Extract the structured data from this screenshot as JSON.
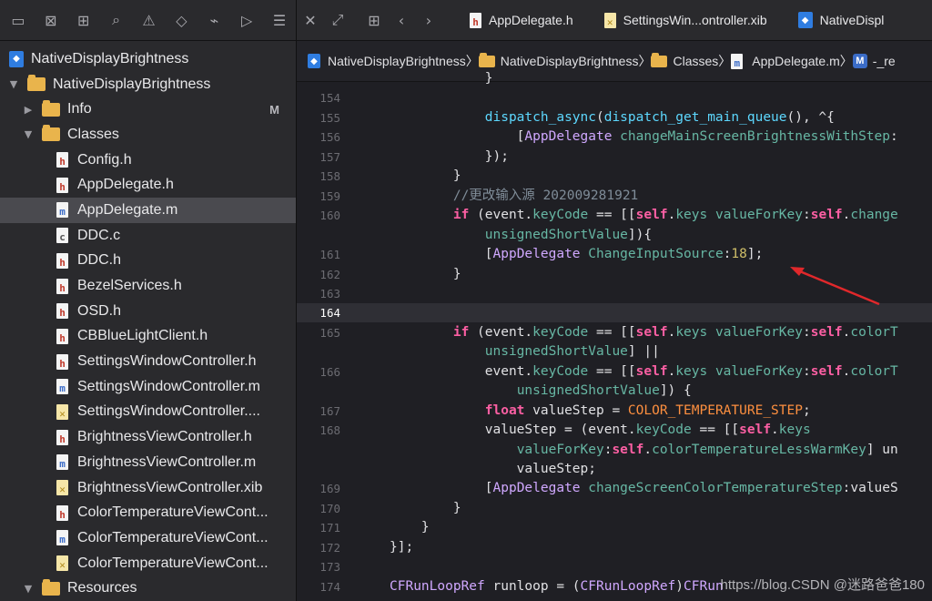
{
  "sidebar": {
    "toolbar_icons": [
      "folder-icon",
      "close-box-icon",
      "hierarchy-icon",
      "search-icon",
      "warning-icon",
      "diamond-icon",
      "spray-icon",
      "label-icon",
      "list-icon"
    ],
    "tree": [
      {
        "label": "NativeDisplayBrightness",
        "kind": "project",
        "indent": 0
      },
      {
        "label": "NativeDisplayBrightness",
        "kind": "folder",
        "indent": 1,
        "open": true
      },
      {
        "label": "Info",
        "kind": "folder",
        "indent": 2,
        "open": false,
        "badge": "M"
      },
      {
        "label": "Classes",
        "kind": "folder",
        "indent": 2,
        "open": true
      },
      {
        "label": "Config.h",
        "kind": "h",
        "indent": 3
      },
      {
        "label": "AppDelegate.h",
        "kind": "h",
        "indent": 3
      },
      {
        "label": "AppDelegate.m",
        "kind": "m",
        "indent": 3,
        "selected": true
      },
      {
        "label": "DDC.c",
        "kind": "c",
        "indent": 3
      },
      {
        "label": "DDC.h",
        "kind": "h",
        "indent": 3
      },
      {
        "label": "BezelServices.h",
        "kind": "h",
        "indent": 3
      },
      {
        "label": "OSD.h",
        "kind": "h",
        "indent": 3
      },
      {
        "label": "CBBlueLightClient.h",
        "kind": "h",
        "indent": 3
      },
      {
        "label": "SettingsWindowController.h",
        "kind": "h",
        "indent": 3
      },
      {
        "label": "SettingsWindowController.m",
        "kind": "m",
        "indent": 3
      },
      {
        "label": "SettingsWindowController....",
        "kind": "x",
        "indent": 3
      },
      {
        "label": "BrightnessViewController.h",
        "kind": "h",
        "indent": 3
      },
      {
        "label": "BrightnessViewController.m",
        "kind": "m",
        "indent": 3
      },
      {
        "label": "BrightnessViewController.xib",
        "kind": "x",
        "indent": 3
      },
      {
        "label": "ColorTemperatureViewCont...",
        "kind": "h",
        "indent": 3
      },
      {
        "label": "ColorTemperatureViewCont...",
        "kind": "m",
        "indent": 3
      },
      {
        "label": "ColorTemperatureViewCont...",
        "kind": "x",
        "indent": 3
      },
      {
        "label": "Resources",
        "kind": "folder",
        "indent": 2,
        "open": true
      }
    ]
  },
  "tabs": [
    {
      "label": "AppDelegate.h",
      "kind": "h"
    },
    {
      "label": "SettingsWin...ontroller.xib",
      "kind": "x"
    },
    {
      "label": "NativeDispl",
      "kind": "project"
    }
  ],
  "breadcrumb": [
    {
      "label": "NativeDisplayBrightness",
      "kind": "project"
    },
    {
      "label": "NativeDisplayBrightness",
      "kind": "folder"
    },
    {
      "label": "Classes",
      "kind": "folder"
    },
    {
      "label": "AppDelegate.m",
      "kind": "m"
    },
    {
      "label": "-_re",
      "kind": "method",
      "badge": "M"
    }
  ],
  "code": [
    {
      "n": "",
      "html": "            }"
    },
    {
      "n": "154",
      "html": ""
    },
    {
      "n": "155",
      "html": "            <span class=\"fn\">dispatch_async</span>(<span class=\"fn\">dispatch_get_main_queue</span>(), ^{"
    },
    {
      "n": "156",
      "html": "                [<span class=\"cls\">AppDelegate</span> <span class=\"prop\">changeMainScreenBrightnessWithStep</span>:"
    },
    {
      "n": "157",
      "html": "            });"
    },
    {
      "n": "158",
      "html": "        }"
    },
    {
      "n": "159",
      "html": "        <span class=\"cmt\">//更改输入源 202009281921</span>"
    },
    {
      "n": "160",
      "html": "        <span class=\"kw\">if</span> (event.<span class=\"prop\">keyCode</span> == [[<span class=\"kw\">self</span>.<span class=\"prop\">keys</span> <span class=\"prop\">valueForKey</span>:<span class=\"kw\">self</span>.<span class=\"prop\">change</span>"
    },
    {
      "n": "",
      "html": "            <span class=\"prop\">unsignedShortValue</span>]){"
    },
    {
      "n": "161",
      "html": "            [<span class=\"cls\">AppDelegate</span> <span class=\"prop\">ChangeInputSource</span>:<span class=\"num\">18</span>];"
    },
    {
      "n": "162",
      "html": "        }"
    },
    {
      "n": "163",
      "html": ""
    },
    {
      "n": "164",
      "html": "",
      "current": true
    },
    {
      "n": "165",
      "html": "        <span class=\"kw\">if</span> (event.<span class=\"prop\">keyCode</span> == [[<span class=\"kw\">self</span>.<span class=\"prop\">keys</span> <span class=\"prop\">valueForKey</span>:<span class=\"kw\">self</span>.<span class=\"prop\">colorT</span>"
    },
    {
      "n": "",
      "html": "            <span class=\"prop\">unsignedShortValue</span>] ||"
    },
    {
      "n": "166",
      "html": "            event.<span class=\"prop\">keyCode</span> == [[<span class=\"kw\">self</span>.<span class=\"prop\">keys</span> <span class=\"prop\">valueForKey</span>:<span class=\"kw\">self</span>.<span class=\"prop\">colorT</span>"
    },
    {
      "n": "",
      "html": "                <span class=\"prop\">unsignedShortValue</span>]) {"
    },
    {
      "n": "167",
      "html": "            <span class=\"kw\">float</span> valueStep = <span class=\"mac\">COLOR_TEMPERATURE_STEP</span>;"
    },
    {
      "n": "168",
      "html": "            valueStep = (event.<span class=\"prop\">keyCode</span> == [[<span class=\"kw\">self</span>.<span class=\"prop\">keys</span>"
    },
    {
      "n": "",
      "html": "                <span class=\"prop\">valueForKey</span>:<span class=\"kw\">self</span>.<span class=\"prop\">colorTemperatureLessWarmKey</span>] un"
    },
    {
      "n": "",
      "html": "                valueStep;"
    },
    {
      "n": "169",
      "html": "            [<span class=\"cls\">AppDelegate</span> <span class=\"prop\">changeScreenColorTemperatureStep</span>:valueS"
    },
    {
      "n": "170",
      "html": "        }"
    },
    {
      "n": "171",
      "html": "    }"
    },
    {
      "n": "172",
      "html": "}];"
    },
    {
      "n": "173",
      "html": ""
    },
    {
      "n": "174",
      "html": "<span class=\"cls\">CFRunLoopRef</span> runloop = (<span class=\"cls\">CFRunLoopRef</span>)<span class=\"cls\">CFRun</span>"
    }
  ],
  "watermark": "https://blog.CSDN @迷路爸爸180"
}
